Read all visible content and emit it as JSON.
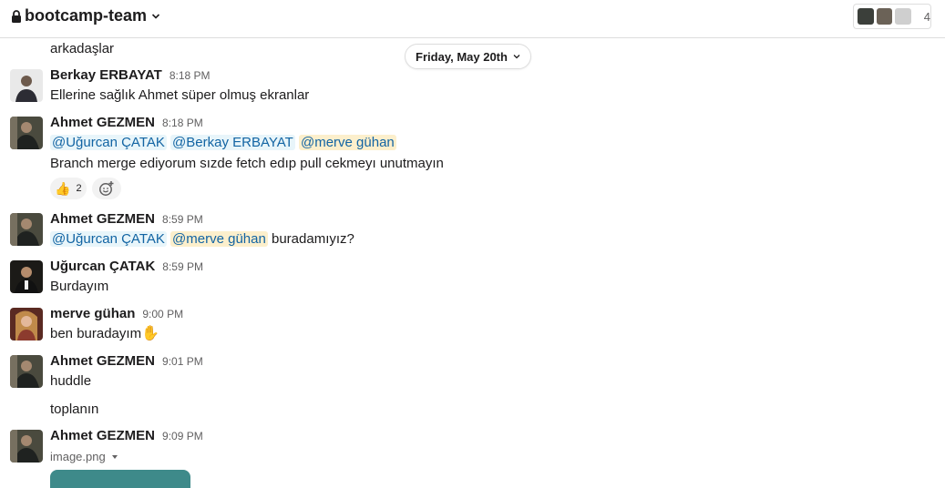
{
  "channel": {
    "name": "bootcamp-team",
    "member_count": "4"
  },
  "date_divider": {
    "label": "Friday, May 20th"
  },
  "messages": [
    {
      "text": "arkadaşlar"
    },
    {
      "author": "Berkay ERBAYAT",
      "time": "8:18 PM",
      "text": "Ellerine sağlık Ahmet süper olmuş ekranlar"
    },
    {
      "author": "Ahmet GEZMEN",
      "time": "8:18 PM",
      "mentions": [
        "@Uğurcan ÇATAK",
        "@Berkay ERBAYAT",
        "@merve gühan"
      ],
      "text": "Branch merge ediyorum sızde fetch edıp pull cekmeyı unutmayın",
      "reaction": {
        "emoji": "👍",
        "count": "2"
      }
    },
    {
      "author": "Ahmet GEZMEN",
      "time": "8:59 PM",
      "mentions": [
        "@Uğurcan ÇATAK",
        "@merve gühan"
      ],
      "text": "buradamıyız?"
    },
    {
      "author": "Uğurcan ÇATAK",
      "time": "8:59 PM",
      "text": "Burdayım"
    },
    {
      "author": "merve gühan",
      "time": "9:00 PM",
      "text": "ben buradayım",
      "emoji": "✋"
    },
    {
      "author": "Ahmet GEZMEN",
      "time": "9:01 PM",
      "text": "huddle"
    },
    {
      "text": "toplanın"
    },
    {
      "author": "Ahmet GEZMEN",
      "time": "9:09 PM",
      "file_name": "image.png"
    }
  ],
  "colors": {
    "mention_bg": "#e8f5fa",
    "mention_self_bg": "#fcefcc",
    "link": "#1264a3"
  }
}
